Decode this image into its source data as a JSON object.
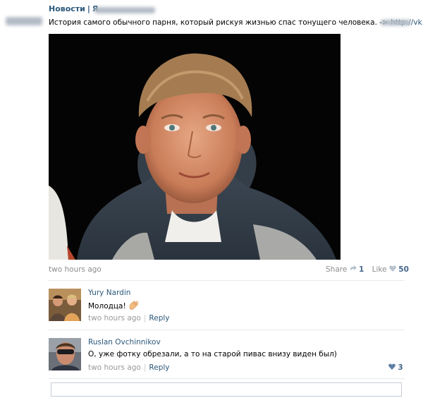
{
  "header": {
    "title": "Новости",
    "separator": "|",
    "source_initial": "Я"
  },
  "post": {
    "text": "История самого обычного парня, который рискуя жизнью спас тонущего человека. ->",
    "link": "http://vk.cc/",
    "time": "two hours ago",
    "share_label": "Share",
    "share_count": "1",
    "like_label": "Like",
    "like_count": "50"
  },
  "comments": [
    {
      "author": "Yury Nardin",
      "text": "Молодца!",
      "time": "two hours ago",
      "reply_label": "Reply"
    },
    {
      "author": "Ruslan Ovchinnikov",
      "text": "О, уже фотку обрезали, а то на старой пивас внизу виден был)",
      "time": "two hours ago",
      "reply_label": "Reply",
      "like_count": "3"
    }
  ],
  "comment_input": {
    "placeholder": ""
  },
  "colors": {
    "link_blue": "#2b587a",
    "meta_gray": "#8d8d8d",
    "divider": "#e7e9ec"
  },
  "icons": [
    "share-icon",
    "heart-icon",
    "clapping-hands-icon"
  ]
}
